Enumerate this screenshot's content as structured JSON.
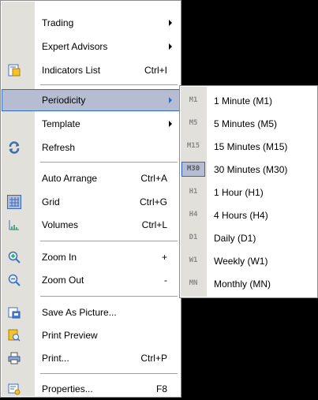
{
  "menu": {
    "items": [
      {
        "label": "Trading",
        "shortcut": "",
        "submenu": true
      },
      {
        "label": "Expert Advisors",
        "shortcut": "",
        "submenu": true
      },
      {
        "label": "Indicators List",
        "shortcut": "Ctrl+I",
        "icon": "indicators-list-icon"
      },
      {
        "label": "Periodicity",
        "shortcut": "",
        "submenu": true,
        "highlighted": true
      },
      {
        "label": "Template",
        "shortcut": "",
        "submenu": true
      },
      {
        "label": "Refresh",
        "shortcut": "",
        "icon": "refresh-icon"
      },
      {
        "label": "Auto Arrange",
        "shortcut": "Ctrl+A"
      },
      {
        "label": "Grid",
        "shortcut": "Ctrl+G",
        "icon": "grid-icon"
      },
      {
        "label": "Volumes",
        "shortcut": "Ctrl+L",
        "icon": "volumes-icon"
      },
      {
        "label": "Zoom In",
        "shortcut": "+",
        "icon": "zoom-in-icon"
      },
      {
        "label": "Zoom Out",
        "shortcut": "-",
        "icon": "zoom-out-icon"
      },
      {
        "label": "Save As Picture...",
        "shortcut": "",
        "icon": "save-picture-icon"
      },
      {
        "label": "Print Preview",
        "shortcut": "",
        "icon": "print-preview-icon"
      },
      {
        "label": "Print...",
        "shortcut": "Ctrl+P",
        "icon": "print-icon"
      },
      {
        "label": "Properties...",
        "shortcut": "F8",
        "icon": "properties-icon"
      }
    ]
  },
  "periodicity_submenu": {
    "items": [
      {
        "code": "M1",
        "label": "1 Minute (M1)"
      },
      {
        "code": "M5",
        "label": "5 Minutes (M5)"
      },
      {
        "code": "M15",
        "label": "15 Minutes (M15)"
      },
      {
        "code": "M30",
        "label": "30 Minutes (M30)",
        "active": true
      },
      {
        "code": "H1",
        "label": "1 Hour (H1)"
      },
      {
        "code": "H4",
        "label": "4 Hours (H4)"
      },
      {
        "code": "D1",
        "label": "Daily (D1)"
      },
      {
        "code": "W1",
        "label": "Weekly (W1)"
      },
      {
        "code": "MN",
        "label": "Monthly (MN)"
      }
    ]
  },
  "colors": {
    "highlight": "#b6bdd2",
    "highlight_border": "#316ac5",
    "gutter": "#e2e0da",
    "background": "#000000"
  }
}
